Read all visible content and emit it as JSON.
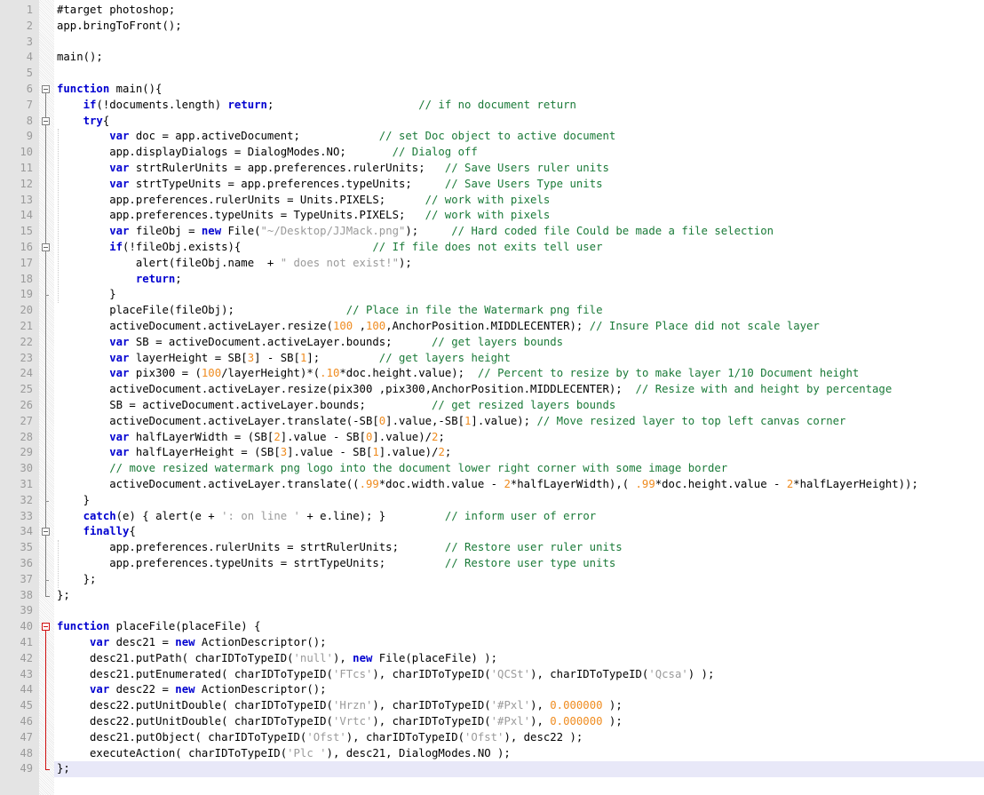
{
  "editor": {
    "title": "photoshop-watermark-script",
    "language": "JavaScript",
    "current_line": 49,
    "colors": {
      "background": "#ffffff",
      "gutter": "#e4e4e4",
      "line_number": "#9a9a9a",
      "keyword": "#0000d0",
      "comment": "#1a7a38",
      "string": "#9a9a9a",
      "number": "#ef8c20",
      "plain": "#000000",
      "current_line_highlight": "#e8e8f8",
      "fold_marker": "#808080",
      "fold_marker_active": "#d01010"
    }
  },
  "lines": [
    {
      "n": 1,
      "fold": null,
      "tokens": [
        {
          "t": "plain",
          "v": "#target photoshop;"
        }
      ]
    },
    {
      "n": 2,
      "fold": null,
      "tokens": [
        {
          "t": "plain",
          "v": "app.bringToFront();"
        }
      ]
    },
    {
      "n": 3,
      "fold": null,
      "tokens": []
    },
    {
      "n": 4,
      "fold": null,
      "tokens": [
        {
          "t": "plain",
          "v": "main();"
        }
      ]
    },
    {
      "n": 5,
      "fold": null,
      "tokens": []
    },
    {
      "n": 6,
      "fold": "open",
      "tokens": [
        {
          "t": "key",
          "v": "function"
        },
        {
          "t": "plain",
          "v": " main(){"
        }
      ]
    },
    {
      "n": 7,
      "fold": null,
      "tokens": [
        {
          "t": "plain",
          "v": "    "
        },
        {
          "t": "key",
          "v": "if"
        },
        {
          "t": "plain",
          "v": "(!documents.length) "
        },
        {
          "t": "key",
          "v": "return"
        },
        {
          "t": "plain",
          "v": ";                      "
        },
        {
          "t": "cmt",
          "v": "// if no document return"
        }
      ]
    },
    {
      "n": 8,
      "fold": "open",
      "tokens": [
        {
          "t": "plain",
          "v": "    "
        },
        {
          "t": "key",
          "v": "try"
        },
        {
          "t": "plain",
          "v": "{"
        }
      ]
    },
    {
      "n": 9,
      "fold": null,
      "tokens": [
        {
          "t": "plain",
          "v": "        "
        },
        {
          "t": "key",
          "v": "var"
        },
        {
          "t": "plain",
          "v": " doc = app.activeDocument;            "
        },
        {
          "t": "cmt",
          "v": "// set Doc object to active document"
        }
      ]
    },
    {
      "n": 10,
      "fold": null,
      "tokens": [
        {
          "t": "plain",
          "v": "        app.displayDialogs = DialogModes.NO;       "
        },
        {
          "t": "cmt",
          "v": "// Dialog off"
        }
      ]
    },
    {
      "n": 11,
      "fold": null,
      "tokens": [
        {
          "t": "plain",
          "v": "        "
        },
        {
          "t": "key",
          "v": "var"
        },
        {
          "t": "plain",
          "v": " strtRulerUnits = app.preferences.rulerUnits;   "
        },
        {
          "t": "cmt",
          "v": "// Save Users ruler units"
        }
      ]
    },
    {
      "n": 12,
      "fold": null,
      "tokens": [
        {
          "t": "plain",
          "v": "        "
        },
        {
          "t": "key",
          "v": "var"
        },
        {
          "t": "plain",
          "v": " strtTypeUnits = app.preferences.typeUnits;     "
        },
        {
          "t": "cmt",
          "v": "// Save Users Type units"
        }
      ]
    },
    {
      "n": 13,
      "fold": null,
      "tokens": [
        {
          "t": "plain",
          "v": "        app.preferences.rulerUnits = Units.PIXELS;      "
        },
        {
          "t": "cmt",
          "v": "// work with pixels"
        }
      ]
    },
    {
      "n": 14,
      "fold": null,
      "tokens": [
        {
          "t": "plain",
          "v": "        app.preferences.typeUnits = TypeUnits.PIXELS;   "
        },
        {
          "t": "cmt",
          "v": "// work with pixels"
        }
      ]
    },
    {
      "n": 15,
      "fold": null,
      "tokens": [
        {
          "t": "plain",
          "v": "        "
        },
        {
          "t": "key",
          "v": "var"
        },
        {
          "t": "plain",
          "v": " fileObj = "
        },
        {
          "t": "key",
          "v": "new"
        },
        {
          "t": "plain",
          "v": " File("
        },
        {
          "t": "str",
          "v": "\"~/Desktop/JJMack.png\""
        },
        {
          "t": "plain",
          "v": ");     "
        },
        {
          "t": "cmt",
          "v": "// Hard coded file Could be made a file selection"
        }
      ]
    },
    {
      "n": 16,
      "fold": "open",
      "tokens": [
        {
          "t": "plain",
          "v": "        "
        },
        {
          "t": "key",
          "v": "if"
        },
        {
          "t": "plain",
          "v": "(!fileObj.exists){                    "
        },
        {
          "t": "cmt",
          "v": "// If file does not exits tell user"
        }
      ]
    },
    {
      "n": 17,
      "fold": null,
      "tokens": [
        {
          "t": "plain",
          "v": "            alert(fileObj.name  + "
        },
        {
          "t": "str",
          "v": "\" does not exist!\""
        },
        {
          "t": "plain",
          "v": ");"
        }
      ]
    },
    {
      "n": 18,
      "fold": null,
      "tokens": [
        {
          "t": "plain",
          "v": "            "
        },
        {
          "t": "key",
          "v": "return"
        },
        {
          "t": "plain",
          "v": ";"
        }
      ]
    },
    {
      "n": 19,
      "fold": "close-tick",
      "tokens": [
        {
          "t": "plain",
          "v": "        }"
        }
      ]
    },
    {
      "n": 20,
      "fold": null,
      "tokens": [
        {
          "t": "plain",
          "v": "        placeFile(fileObj);                 "
        },
        {
          "t": "cmt",
          "v": "// Place in file the Watermark png file"
        }
      ]
    },
    {
      "n": 21,
      "fold": null,
      "tokens": [
        {
          "t": "plain",
          "v": "        activeDocument.activeLayer.resize("
        },
        {
          "t": "num",
          "v": "100"
        },
        {
          "t": "plain",
          "v": " ,"
        },
        {
          "t": "num",
          "v": "100"
        },
        {
          "t": "plain",
          "v": ",AnchorPosition.MIDDLECENTER); "
        },
        {
          "t": "cmt",
          "v": "// Insure Place did not scale layer"
        }
      ]
    },
    {
      "n": 22,
      "fold": null,
      "tokens": [
        {
          "t": "plain",
          "v": "        "
        },
        {
          "t": "key",
          "v": "var"
        },
        {
          "t": "plain",
          "v": " SB = activeDocument.activeLayer.bounds;      "
        },
        {
          "t": "cmt",
          "v": "// get layers bounds"
        }
      ]
    },
    {
      "n": 23,
      "fold": null,
      "tokens": [
        {
          "t": "plain",
          "v": "        "
        },
        {
          "t": "key",
          "v": "var"
        },
        {
          "t": "plain",
          "v": " layerHeight = SB["
        },
        {
          "t": "num",
          "v": "3"
        },
        {
          "t": "plain",
          "v": "] - SB["
        },
        {
          "t": "num",
          "v": "1"
        },
        {
          "t": "plain",
          "v": "];         "
        },
        {
          "t": "cmt",
          "v": "// get layers height"
        }
      ]
    },
    {
      "n": 24,
      "fold": null,
      "tokens": [
        {
          "t": "plain",
          "v": "        "
        },
        {
          "t": "key",
          "v": "var"
        },
        {
          "t": "plain",
          "v": " pix300 = ("
        },
        {
          "t": "num",
          "v": "100"
        },
        {
          "t": "plain",
          "v": "/layerHeight)*("
        },
        {
          "t": "num",
          "v": ".10"
        },
        {
          "t": "plain",
          "v": "*doc.height.value);  "
        },
        {
          "t": "cmt",
          "v": "// Percent to resize by to make layer 1/10 Document height"
        }
      ]
    },
    {
      "n": 25,
      "fold": null,
      "tokens": [
        {
          "t": "plain",
          "v": "        activeDocument.activeLayer.resize(pix300 ,pix300,AnchorPosition.MIDDLECENTER);  "
        },
        {
          "t": "cmt",
          "v": "// Resize with and height by percentage"
        }
      ]
    },
    {
      "n": 26,
      "fold": null,
      "tokens": [
        {
          "t": "plain",
          "v": "        SB = activeDocument.activeLayer.bounds;          "
        },
        {
          "t": "cmt",
          "v": "// get resized layers bounds"
        }
      ]
    },
    {
      "n": 27,
      "fold": null,
      "tokens": [
        {
          "t": "plain",
          "v": "        activeDocument.activeLayer.translate(-SB["
        },
        {
          "t": "num",
          "v": "0"
        },
        {
          "t": "plain",
          "v": "].value,-SB["
        },
        {
          "t": "num",
          "v": "1"
        },
        {
          "t": "plain",
          "v": "].value); "
        },
        {
          "t": "cmt",
          "v": "// Move resized layer to top left canvas corner"
        }
      ]
    },
    {
      "n": 28,
      "fold": null,
      "tokens": [
        {
          "t": "plain",
          "v": "        "
        },
        {
          "t": "key",
          "v": "var"
        },
        {
          "t": "plain",
          "v": " halfLayerWidth = (SB["
        },
        {
          "t": "num",
          "v": "2"
        },
        {
          "t": "plain",
          "v": "].value - SB["
        },
        {
          "t": "num",
          "v": "0"
        },
        {
          "t": "plain",
          "v": "].value)/"
        },
        {
          "t": "num",
          "v": "2"
        },
        {
          "t": "plain",
          "v": ";"
        }
      ]
    },
    {
      "n": 29,
      "fold": null,
      "tokens": [
        {
          "t": "plain",
          "v": "        "
        },
        {
          "t": "key",
          "v": "var"
        },
        {
          "t": "plain",
          "v": " halfLayerHeight = (SB["
        },
        {
          "t": "num",
          "v": "3"
        },
        {
          "t": "plain",
          "v": "].value - SB["
        },
        {
          "t": "num",
          "v": "1"
        },
        {
          "t": "plain",
          "v": "].value)/"
        },
        {
          "t": "num",
          "v": "2"
        },
        {
          "t": "plain",
          "v": ";"
        }
      ]
    },
    {
      "n": 30,
      "fold": null,
      "tokens": [
        {
          "t": "plain",
          "v": "        "
        },
        {
          "t": "cmt",
          "v": "// move resized watermark png logo into the document lower right corner with some image border"
        }
      ]
    },
    {
      "n": 31,
      "fold": null,
      "tokens": [
        {
          "t": "plain",
          "v": "        activeDocument.activeLayer.translate(("
        },
        {
          "t": "num",
          "v": ".99"
        },
        {
          "t": "plain",
          "v": "*doc.width.value - "
        },
        {
          "t": "num",
          "v": "2"
        },
        {
          "t": "plain",
          "v": "*halfLayerWidth),( "
        },
        {
          "t": "num",
          "v": ".99"
        },
        {
          "t": "plain",
          "v": "*doc.height.value - "
        },
        {
          "t": "num",
          "v": "2"
        },
        {
          "t": "plain",
          "v": "*halfLayerHeight));"
        }
      ]
    },
    {
      "n": 32,
      "fold": "close-tick",
      "tokens": [
        {
          "t": "plain",
          "v": "    }"
        }
      ]
    },
    {
      "n": 33,
      "fold": null,
      "tokens": [
        {
          "t": "plain",
          "v": "    "
        },
        {
          "t": "key",
          "v": "catch"
        },
        {
          "t": "plain",
          "v": "(e) { alert(e + "
        },
        {
          "t": "str",
          "v": "': on line '"
        },
        {
          "t": "plain",
          "v": " + e.line); }         "
        },
        {
          "t": "cmt",
          "v": "// inform user of error"
        }
      ]
    },
    {
      "n": 34,
      "fold": "open",
      "tokens": [
        {
          "t": "plain",
          "v": "    "
        },
        {
          "t": "key",
          "v": "finally"
        },
        {
          "t": "plain",
          "v": "{"
        }
      ]
    },
    {
      "n": 35,
      "fold": null,
      "tokens": [
        {
          "t": "plain",
          "v": "        app.preferences.rulerUnits = strtRulerUnits;       "
        },
        {
          "t": "cmt",
          "v": "// Restore user ruler units"
        }
      ]
    },
    {
      "n": 36,
      "fold": null,
      "tokens": [
        {
          "t": "plain",
          "v": "        app.preferences.typeUnits = strtTypeUnits;         "
        },
        {
          "t": "cmt",
          "v": "// Restore user type units"
        }
      ]
    },
    {
      "n": 37,
      "fold": "close-tick",
      "tokens": [
        {
          "t": "plain",
          "v": "    };"
        }
      ]
    },
    {
      "n": 38,
      "fold": "close",
      "tokens": [
        {
          "t": "plain",
          "v": "};"
        }
      ]
    },
    {
      "n": 39,
      "fold": null,
      "tokens": []
    },
    {
      "n": 40,
      "fold": "open-active",
      "tokens": [
        {
          "t": "key",
          "v": "function"
        },
        {
          "t": "plain",
          "v": " placeFile(placeFile) {"
        }
      ]
    },
    {
      "n": 41,
      "fold": null,
      "tokens": [
        {
          "t": "plain",
          "v": "     "
        },
        {
          "t": "key",
          "v": "var"
        },
        {
          "t": "plain",
          "v": " desc21 = "
        },
        {
          "t": "key",
          "v": "new"
        },
        {
          "t": "plain",
          "v": " ActionDescriptor();"
        }
      ]
    },
    {
      "n": 42,
      "fold": null,
      "tokens": [
        {
          "t": "plain",
          "v": "     desc21.putPath( charIDToTypeID("
        },
        {
          "t": "str",
          "v": "'null'"
        },
        {
          "t": "plain",
          "v": "), "
        },
        {
          "t": "key",
          "v": "new"
        },
        {
          "t": "plain",
          "v": " File(placeFile) );"
        }
      ]
    },
    {
      "n": 43,
      "fold": null,
      "tokens": [
        {
          "t": "plain",
          "v": "     desc21.putEnumerated( charIDToTypeID("
        },
        {
          "t": "str",
          "v": "'FTcs'"
        },
        {
          "t": "plain",
          "v": "), charIDToTypeID("
        },
        {
          "t": "str",
          "v": "'QCSt'"
        },
        {
          "t": "plain",
          "v": "), charIDToTypeID("
        },
        {
          "t": "str",
          "v": "'Qcsa'"
        },
        {
          "t": "plain",
          "v": ") );"
        }
      ]
    },
    {
      "n": 44,
      "fold": null,
      "tokens": [
        {
          "t": "plain",
          "v": "     "
        },
        {
          "t": "key",
          "v": "var"
        },
        {
          "t": "plain",
          "v": " desc22 = "
        },
        {
          "t": "key",
          "v": "new"
        },
        {
          "t": "plain",
          "v": " ActionDescriptor();"
        }
      ]
    },
    {
      "n": 45,
      "fold": null,
      "tokens": [
        {
          "t": "plain",
          "v": "     desc22.putUnitDouble( charIDToTypeID("
        },
        {
          "t": "str",
          "v": "'Hrzn'"
        },
        {
          "t": "plain",
          "v": "), charIDToTypeID("
        },
        {
          "t": "str",
          "v": "'#Pxl'"
        },
        {
          "t": "plain",
          "v": "), "
        },
        {
          "t": "num",
          "v": "0.000000"
        },
        {
          "t": "plain",
          "v": " );"
        }
      ]
    },
    {
      "n": 46,
      "fold": null,
      "tokens": [
        {
          "t": "plain",
          "v": "     desc22.putUnitDouble( charIDToTypeID("
        },
        {
          "t": "str",
          "v": "'Vrtc'"
        },
        {
          "t": "plain",
          "v": "), charIDToTypeID("
        },
        {
          "t": "str",
          "v": "'#Pxl'"
        },
        {
          "t": "plain",
          "v": "), "
        },
        {
          "t": "num",
          "v": "0.000000"
        },
        {
          "t": "plain",
          "v": " );"
        }
      ]
    },
    {
      "n": 47,
      "fold": null,
      "tokens": [
        {
          "t": "plain",
          "v": "     desc21.putObject( charIDToTypeID("
        },
        {
          "t": "str",
          "v": "'Ofst'"
        },
        {
          "t": "plain",
          "v": "), charIDToTypeID("
        },
        {
          "t": "str",
          "v": "'Ofst'"
        },
        {
          "t": "plain",
          "v": "), desc22 );"
        }
      ]
    },
    {
      "n": 48,
      "fold": null,
      "tokens": [
        {
          "t": "plain",
          "v": "     executeAction( charIDToTypeID("
        },
        {
          "t": "str",
          "v": "'Plc '"
        },
        {
          "t": "plain",
          "v": "), desc21, DialogModes.NO );"
        }
      ]
    },
    {
      "n": 49,
      "fold": "close-active",
      "tokens": [
        {
          "t": "plain",
          "v": "};"
        }
      ]
    }
  ],
  "fold_regions": [
    {
      "start": 6,
      "end": 38,
      "active": false
    },
    {
      "start": 8,
      "end": 37,
      "active": false
    },
    {
      "start": 16,
      "end": 19,
      "active": false
    },
    {
      "start": 34,
      "end": 37,
      "active": false
    },
    {
      "start": 40,
      "end": 49,
      "active": true
    }
  ]
}
